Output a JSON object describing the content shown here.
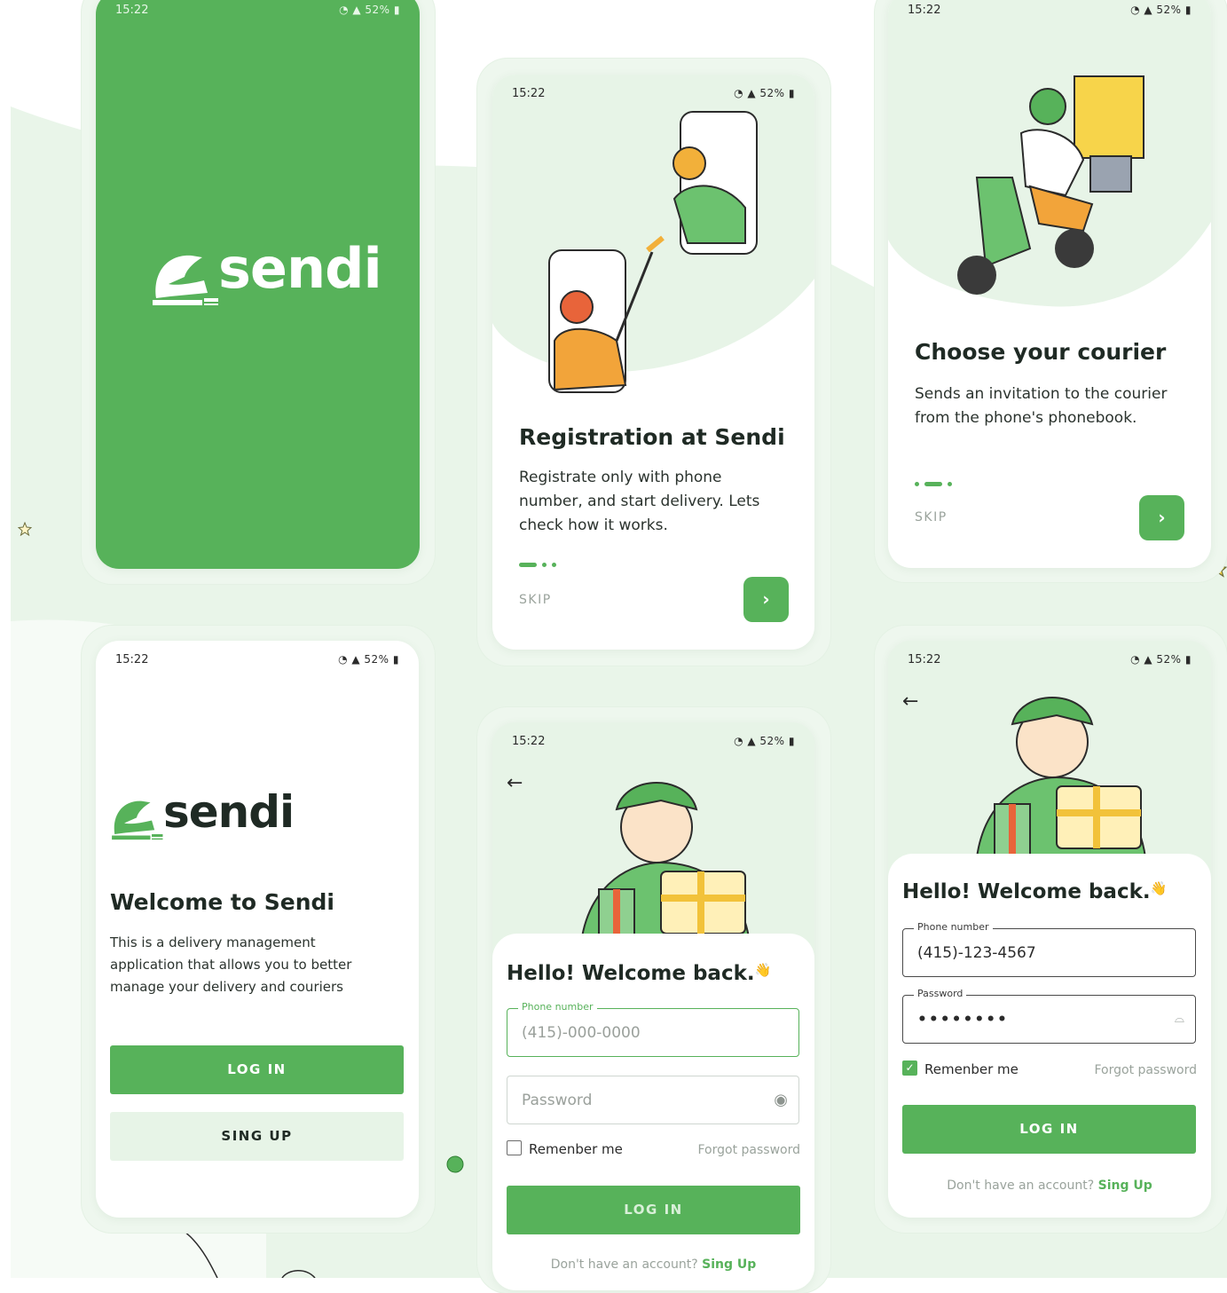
{
  "status": {
    "time": "15:22",
    "battery": "52%"
  },
  "brand": {
    "name": "sendi"
  },
  "onboarding1": {
    "title": "Registration at Sendi",
    "body": "Registrate only with phone number, and start delivery. Lets check how it works.",
    "skip": "SKIP",
    "next": "›"
  },
  "onboarding2": {
    "title": "Choose your courier",
    "body": "Sends an invitation to the courier from the phone's phonebook.",
    "skip": "SKIP",
    "next": "›"
  },
  "welcome": {
    "title": "Welcome to Sendi",
    "body": "This is a delivery management application that allows you to better manage your delivery and couriers",
    "login": "LOG IN",
    "signup": "SING UP"
  },
  "login_empty": {
    "greeting": "Hello! Welcome back.",
    "phone_label": "Phone number",
    "phone_placeholder": "(415)-000-0000",
    "password_placeholder": "Password",
    "remember": "Remenber me",
    "forgot": "Forgot password",
    "login": "LOG IN",
    "no_account": "Don't have an account?",
    "signup_link": "Sing Up"
  },
  "login_filled": {
    "greeting": "Hello! Welcome back.",
    "phone_label": "Phone number",
    "phone_value": "(415)-123-4567",
    "password_label": "Password",
    "password_value": "••••••••",
    "remember": "Remenber me",
    "forgot": "Forgot password",
    "login": "LOG IN",
    "no_account": "Don't have an account?",
    "signup_link": "Sing Up"
  },
  "colors": {
    "primary": "#57b25a",
    "tint": "#e7f4e7",
    "text": "#1f2a24"
  },
  "icons": [
    "wifi-icon",
    "signal-icon",
    "battery-icon",
    "back-arrow-icon",
    "eye-icon",
    "eye-closed-icon",
    "chevron-right-icon",
    "wave-hand-icon",
    "star-icon"
  ]
}
